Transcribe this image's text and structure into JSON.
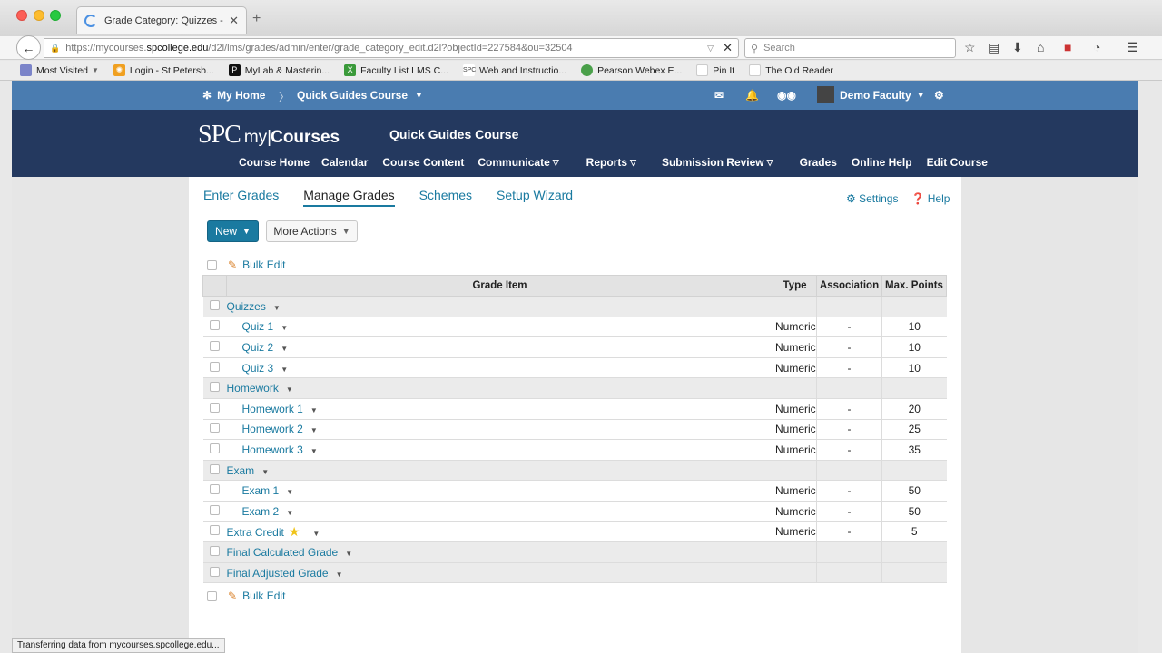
{
  "browser": {
    "tab_title": "Grade Category: Quizzes - ...",
    "url_prefix": "https://mycourses.",
    "url_domain": "spcollege.edu",
    "url_rest": "/d2l/lms/grades/admin/enter/grade_category_edit.d2l?objectId=227584&ou=32504",
    "search_placeholder": "Search",
    "bookmarks": [
      {
        "label": "Most Visited",
        "icon": "folder-icon",
        "color": "#7b84c9"
      },
      {
        "label": "Login - St Petersb...",
        "icon": "spc-sun-icon",
        "color": "#f0a020"
      },
      {
        "label": "MyLab & Masterin...",
        "icon": "pearson-p-icon",
        "color": "#111111"
      },
      {
        "label": "Faculty List LMS C...",
        "icon": "excel-icon",
        "color": "#3a9a3a"
      },
      {
        "label": "Web and Instructio...",
        "icon": "spc-logo-icon",
        "color": "#444444"
      },
      {
        "label": "Pearson Webex E...",
        "icon": "globe-icon",
        "color": "#4aa04a"
      },
      {
        "label": "Pin It",
        "icon": "page-icon",
        "color": "#dddddd"
      },
      {
        "label": "The Old Reader",
        "icon": "page-icon",
        "color": "#dddddd"
      }
    ]
  },
  "minibar": {
    "home": "My Home",
    "course": "Quick Guides Course",
    "user": "Demo Faculty"
  },
  "header": {
    "logo_spc": "SPC",
    "logo_my": "my",
    "logo_courses": "Courses",
    "course_title": "Quick Guides Course",
    "nav": [
      {
        "label": "Course Home",
        "dropdown": false,
        "gap": 0
      },
      {
        "label": "Calendar",
        "dropdown": false,
        "gap": 0
      },
      {
        "label": "Course Content",
        "dropdown": false,
        "gap": 0
      },
      {
        "label": "Communicate",
        "dropdown": true,
        "gap": 0
      },
      {
        "label": "Reports",
        "dropdown": true,
        "gap": 0
      },
      {
        "label": "Submission Review",
        "dropdown": true,
        "gap": 0
      },
      {
        "label": "Grades",
        "dropdown": false,
        "gap": 0
      },
      {
        "label": "Online Help",
        "dropdown": false,
        "gap": 0
      },
      {
        "label": "Edit Course",
        "dropdown": false,
        "gap": 0
      }
    ]
  },
  "subtabs": [
    "Enter Grades",
    "Manage Grades",
    "Schemes",
    "Setup Wizard"
  ],
  "active_subtab": "Manage Grades",
  "settings_label": "Settings",
  "help_label": "Help",
  "buttons": {
    "new": "New",
    "more_actions": "More Actions"
  },
  "bulk_edit": "Bulk Edit",
  "table": {
    "headers": [
      "Grade Item",
      "Type",
      "Association",
      "Max. Points"
    ],
    "rows": [
      {
        "name": "Quizzes",
        "level": 0,
        "type": "",
        "assoc": "",
        "max": "",
        "category": true
      },
      {
        "name": "Quiz 1",
        "level": 1,
        "type": "Numeric",
        "assoc": "-",
        "max": "10",
        "category": false
      },
      {
        "name": "Quiz 2",
        "level": 1,
        "type": "Numeric",
        "assoc": "-",
        "max": "10",
        "category": false
      },
      {
        "name": "Quiz 3",
        "level": 1,
        "type": "Numeric",
        "assoc": "-",
        "max": "10",
        "category": false
      },
      {
        "name": "Homework",
        "level": 0,
        "type": "",
        "assoc": "",
        "max": "",
        "category": true
      },
      {
        "name": "Homework 1",
        "level": 1,
        "type": "Numeric",
        "assoc": "-",
        "max": "20",
        "category": false
      },
      {
        "name": "Homework 2",
        "level": 1,
        "type": "Numeric",
        "assoc": "-",
        "max": "25",
        "category": false
      },
      {
        "name": "Homework 3",
        "level": 1,
        "type": "Numeric",
        "assoc": "-",
        "max": "35",
        "category": false
      },
      {
        "name": "Exam",
        "level": 0,
        "type": "",
        "assoc": "",
        "max": "",
        "category": true
      },
      {
        "name": "Exam 1",
        "level": 1,
        "type": "Numeric",
        "assoc": "-",
        "max": "50",
        "category": false
      },
      {
        "name": "Exam 2",
        "level": 1,
        "type": "Numeric",
        "assoc": "-",
        "max": "50",
        "category": false
      },
      {
        "name": "Extra Credit",
        "level": 0,
        "type": "Numeric",
        "assoc": "-",
        "max": "5",
        "category": false,
        "star": true
      },
      {
        "name": "Final Calculated Grade",
        "level": 0,
        "type": "",
        "assoc": "",
        "max": "",
        "category": true
      },
      {
        "name": "Final Adjusted Grade",
        "level": 0,
        "type": "",
        "assoc": "",
        "max": "",
        "category": true
      }
    ]
  },
  "status_text": "Transferring data from mycourses.spcollege.edu...",
  "colors": {
    "accent": "#1a7aa0",
    "header": "#24395f",
    "minibar": "#4a7cb0"
  }
}
